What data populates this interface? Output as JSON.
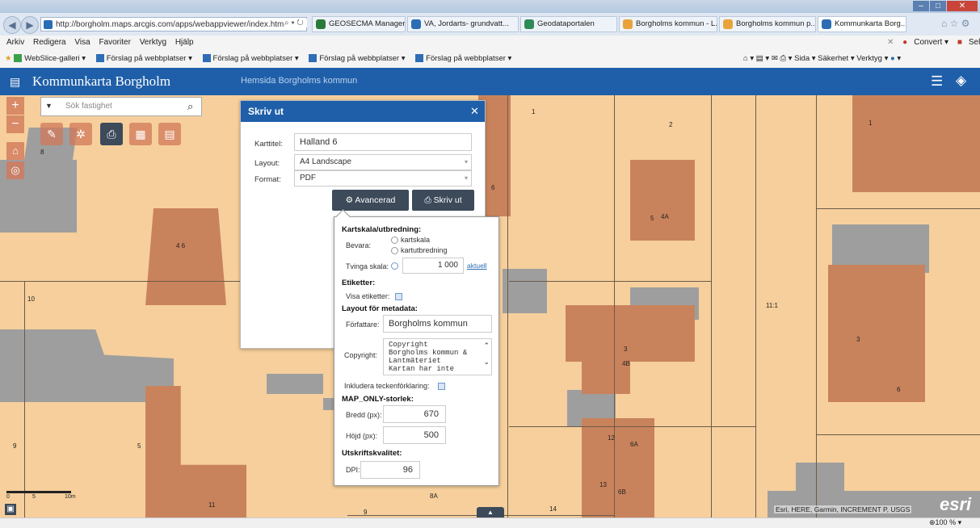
{
  "browser": {
    "url": "http://borgholm.maps.arcgis.com/apps/webappviewer/index.html?",
    "tabs": [
      {
        "label": "GEOSECMA Manager",
        "color": "#2a7a3a"
      },
      {
        "label": "VA, Jordarts- grundvatt...",
        "color": "#2a6db5"
      },
      {
        "label": "Geodataportalen",
        "color": "#2e8b57"
      },
      {
        "label": "Borgholms kommun - L...",
        "color": "#e8a33a"
      },
      {
        "label": "Borgholms kommun p...",
        "color": "#e8a33a"
      },
      {
        "label": "Kommunkarta Borg...",
        "color": "#2a6db5"
      }
    ],
    "menu": [
      "Arkiv",
      "Redigera",
      "Visa",
      "Favoriter",
      "Verktyg",
      "Hjälp"
    ],
    "menu_right": {
      "convert": "Convert",
      "select": "Select"
    },
    "favorites": [
      "WebSlice-galleri",
      "Förslag på webbplatser",
      "Förslag på webbplatser",
      "Förslag på webbplatser",
      "Förslag på webbplatser"
    ],
    "cmd_right": [
      "Sida",
      "Säkerhet",
      "Verktyg"
    ],
    "zoom": "100 %"
  },
  "app": {
    "title": "Kommunkarta Borgholm",
    "link": "Hemsida Borgholms kommun",
    "search_placeholder": "Sök fastighet"
  },
  "print": {
    "title": "Skriv ut",
    "karttitel_label": "Karttitel:",
    "karttitel_value": "Halland 6",
    "layout_label": "Layout:",
    "layout_value": "A4 Landscape",
    "format_label": "Format:",
    "format_value": "PDF",
    "advanced_button": "Avancerad",
    "print_button": "Skriv ut"
  },
  "advanced": {
    "scale_header": "Kartskala/utbredning:",
    "bevara_label": "Bevara:",
    "opt_kartskala": "kartskala",
    "opt_kartutbredning": "kartutbredning",
    "force_scale_label": "Tvinga skala:",
    "scale_value": "1 000",
    "current_link": "aktuell",
    "labels_header": "Etiketter:",
    "show_labels": "Visa etiketter:",
    "meta_header": "Layout för metadata:",
    "author_label": "Författare:",
    "author_value": "Borgholms kommun",
    "copyright_label": "Copyright:",
    "copyright_lines": [
      "Copyright",
      "Borgholms kommun &",
      "Lantmäteriet",
      "Kartan har inte"
    ],
    "legend_label": "Inkludera teckenförklaring:",
    "maponly_header": "MAP_ONLY-storlek:",
    "width_label": "Bredd (px):",
    "width_value": "670",
    "height_label": "Höjd (px):",
    "height_value": "500",
    "quality_header": "Utskriftskvalitet:",
    "dpi_label": "DPI:",
    "dpi_value": "96"
  },
  "map": {
    "attribution": "Esri, HERE, Garmin, INCREMENT P, USGS",
    "scalebar": [
      "0",
      "5",
      "10m"
    ],
    "parcel_labels": [
      "1",
      "2",
      "1",
      "4 6",
      "6",
      "5",
      "4A",
      "10",
      "11:1",
      "3",
      "4B",
      "3",
      "6",
      "12",
      "6A",
      "5",
      "9",
      "11",
      "13",
      "6B",
      "9",
      "14",
      "8A",
      "8"
    ],
    "esri_logo": "esri"
  }
}
